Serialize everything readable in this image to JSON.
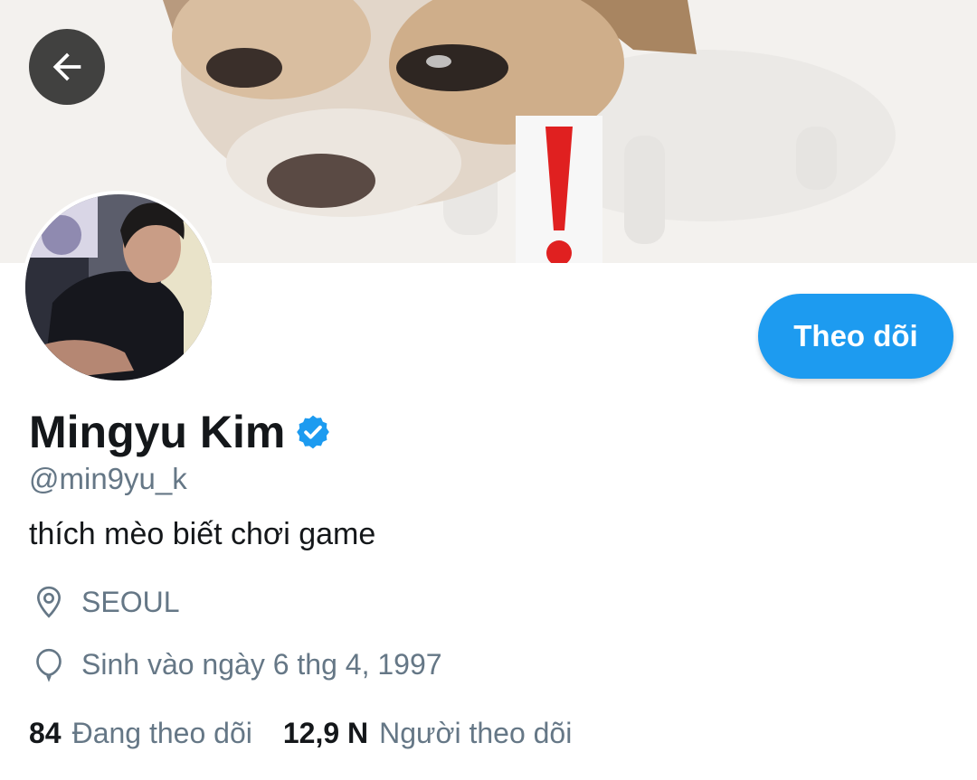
{
  "colors": {
    "accent": "#1d9bf0",
    "text_primary": "#14171a",
    "text_secondary": "#657786",
    "back_button_bg": "#282828"
  },
  "header": {
    "back_icon": "arrow-left-icon"
  },
  "profile": {
    "name": "Mingyu Kim",
    "verified_icon": "verified-badge-icon",
    "handle": "@min9yu_k",
    "bio": "thích mèo biết chơi game",
    "location_icon": "location-pin-icon",
    "location": "SEOUL",
    "birthday_icon": "balloon-icon",
    "birthday": "Sinh vào ngày 6 thg 4, 1997"
  },
  "actions": {
    "follow_label": "Theo dõi"
  },
  "stats": {
    "following_count": "84",
    "following_label": "Đang theo dõi",
    "followers_count": "12,9 N",
    "followers_label": "Người theo dõi"
  }
}
